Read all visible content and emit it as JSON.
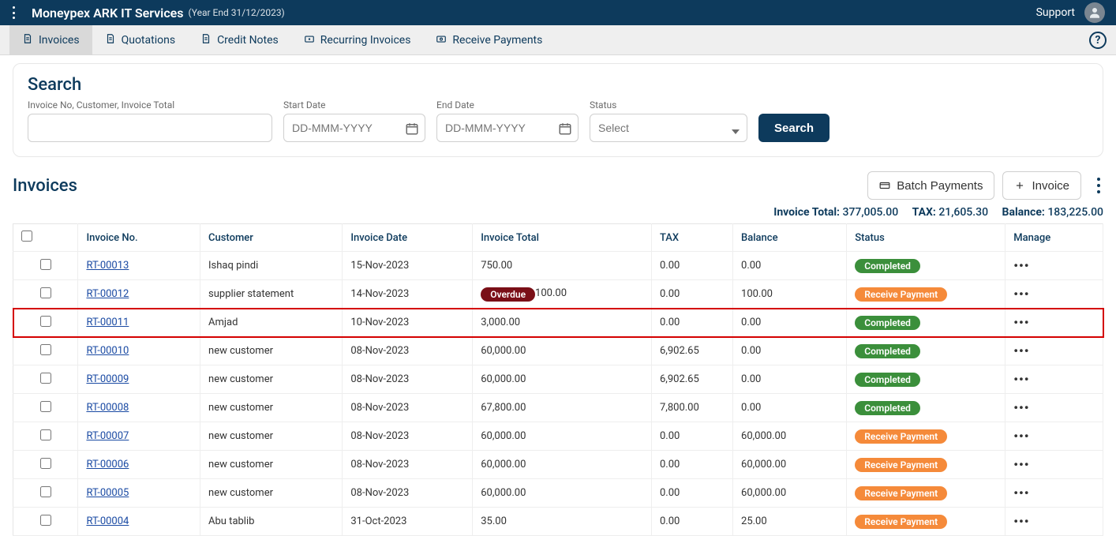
{
  "header": {
    "brand": "Moneypex ARK IT Services",
    "brand_sub": "(Year End 31/12/2023)",
    "support": "Support"
  },
  "tabs": [
    {
      "label": "Invoices",
      "icon": "file-invoice-icon",
      "active": true
    },
    {
      "label": "Quotations",
      "icon": "file-invoice-icon",
      "active": false
    },
    {
      "label": "Credit Notes",
      "icon": "file-invoice-icon",
      "active": false
    },
    {
      "label": "Recurring Invoices",
      "icon": "recurring-icon",
      "active": false
    },
    {
      "label": "Receive Payments",
      "icon": "payment-icon",
      "active": false
    }
  ],
  "search": {
    "title": "Search",
    "generic_label": "Invoice No, Customer, Invoice Total",
    "start_label": "Start Date",
    "end_label": "End Date",
    "date_placeholder": "DD-MMM-YYYY",
    "status_label": "Status",
    "status_placeholder": "Select",
    "search_btn": "Search"
  },
  "section": {
    "title": "Invoices",
    "batch_btn": "Batch Payments",
    "invoice_btn": "Invoice"
  },
  "totals": {
    "invoice_total_label": "Invoice Total:",
    "invoice_total": "377,005.00",
    "tax_label": "TAX:",
    "tax": "21,605.30",
    "balance_label": "Balance:",
    "balance": "183,225.00"
  },
  "columns": {
    "inv": "Invoice No.",
    "cust": "Customer",
    "date": "Invoice Date",
    "total": "Invoice Total",
    "tax": "TAX",
    "balance": "Balance",
    "status": "Status",
    "manage": "Manage"
  },
  "status_labels": {
    "completed": "Completed",
    "receive": "Receive Payment",
    "overdue": "Overdue"
  },
  "rows": [
    {
      "inv": "RT-00013",
      "cust": "Ishaq pindi",
      "date": "15-Nov-2023",
      "total": "750.00",
      "tax": "0.00",
      "balance": "0.00",
      "status": "completed",
      "overdue": false,
      "highlight": false
    },
    {
      "inv": "RT-00012",
      "cust": "supplier statement",
      "date": "14-Nov-2023",
      "total": "100.00",
      "tax": "0.00",
      "balance": "100.00",
      "status": "receive",
      "overdue": true,
      "highlight": false
    },
    {
      "inv": "RT-00011",
      "cust": "Amjad",
      "date": "10-Nov-2023",
      "total": "3,000.00",
      "tax": "0.00",
      "balance": "0.00",
      "status": "completed",
      "overdue": false,
      "highlight": true
    },
    {
      "inv": "RT-00010",
      "cust": "new customer",
      "date": "08-Nov-2023",
      "total": "60,000.00",
      "tax": "6,902.65",
      "balance": "0.00",
      "status": "completed",
      "overdue": false,
      "highlight": false
    },
    {
      "inv": "RT-00009",
      "cust": "new customer",
      "date": "08-Nov-2023",
      "total": "60,000.00",
      "tax": "6,902.65",
      "balance": "0.00",
      "status": "completed",
      "overdue": false,
      "highlight": false
    },
    {
      "inv": "RT-00008",
      "cust": "new customer",
      "date": "08-Nov-2023",
      "total": "67,800.00",
      "tax": "7,800.00",
      "balance": "0.00",
      "status": "completed",
      "overdue": false,
      "highlight": false
    },
    {
      "inv": "RT-00007",
      "cust": "new customer",
      "date": "08-Nov-2023",
      "total": "60,000.00",
      "tax": "0.00",
      "balance": "60,000.00",
      "status": "receive",
      "overdue": false,
      "highlight": false
    },
    {
      "inv": "RT-00006",
      "cust": "new customer",
      "date": "08-Nov-2023",
      "total": "60,000.00",
      "tax": "0.00",
      "balance": "60,000.00",
      "status": "receive",
      "overdue": false,
      "highlight": false
    },
    {
      "inv": "RT-00005",
      "cust": "new customer",
      "date": "08-Nov-2023",
      "total": "60,000.00",
      "tax": "0.00",
      "balance": "60,000.00",
      "status": "receive",
      "overdue": false,
      "highlight": false
    },
    {
      "inv": "RT-00004",
      "cust": "Abu tablib",
      "date": "31-Oct-2023",
      "total": "35.00",
      "tax": "0.00",
      "balance": "25.00",
      "status": "receive",
      "overdue": false,
      "highlight": false
    }
  ]
}
